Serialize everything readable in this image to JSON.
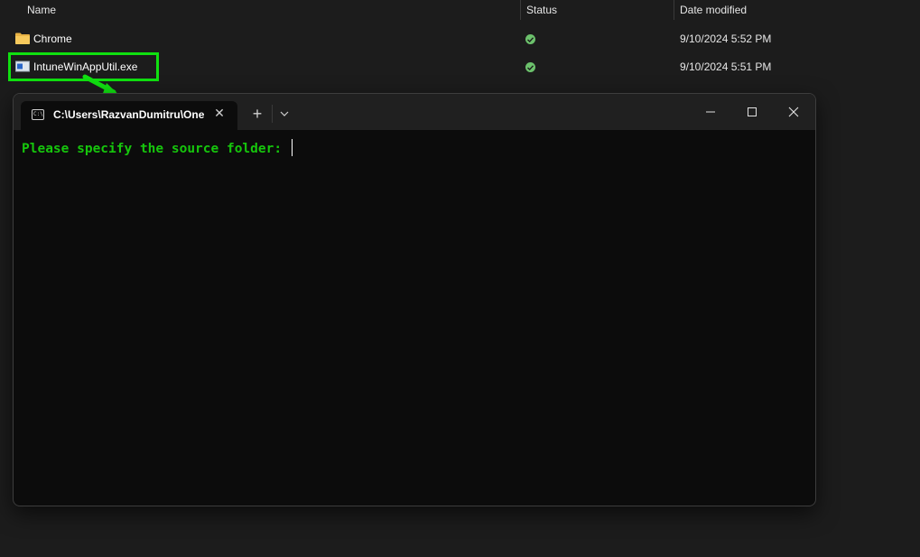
{
  "explorer": {
    "columns": {
      "name": "Name",
      "status": "Status",
      "date_modified": "Date modified"
    },
    "files": [
      {
        "name": "Chrome",
        "icon": "folder-icon",
        "status": "available-status-icon",
        "date_modified": "9/10/2024 5:52 PM"
      },
      {
        "name": "IntuneWinAppUtil.exe",
        "icon": "exe-icon",
        "status": "available-status-icon",
        "date_modified": "9/10/2024 5:51 PM"
      }
    ],
    "highlight_color": "#10e010"
  },
  "terminal": {
    "tab": {
      "title": "C:\\Users\\RazvanDumitru\\One",
      "icon": "cmd-icon",
      "close_icon": "close-icon"
    },
    "new_tab_label": "+",
    "dropdown_icon": "chevron-down-icon",
    "window_controls": {
      "minimize_icon": "minimize-icon",
      "maximize_icon": "maximize-icon",
      "close_icon": "close-icon"
    },
    "console_text": "Please specify the source folder: ",
    "console_color": "#16c60c"
  }
}
